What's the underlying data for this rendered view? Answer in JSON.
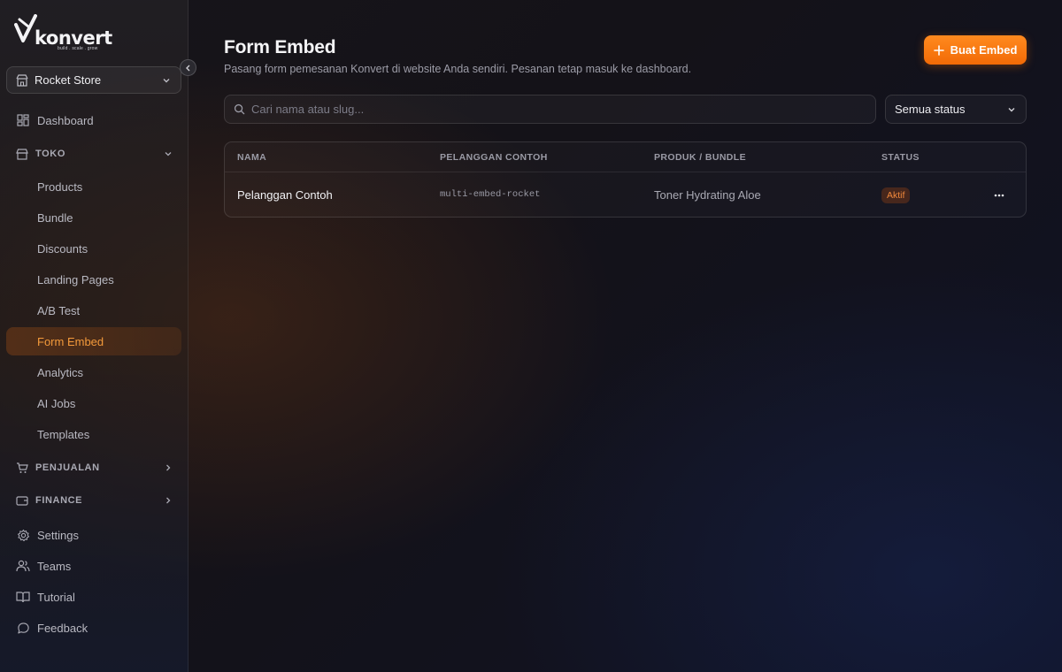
{
  "brand": {
    "name": "konvert",
    "tagline": "build . scale . grow"
  },
  "sidebar": {
    "store": "Rocket Store",
    "items": [
      {
        "label": "Dashboard"
      },
      {
        "label": "TOKO"
      },
      {
        "label": "Products"
      },
      {
        "label": "Bundle"
      },
      {
        "label": "Discounts"
      },
      {
        "label": "Landing Pages"
      },
      {
        "label": "A/B Test"
      },
      {
        "label": "Form Embed"
      },
      {
        "label": "Analytics"
      },
      {
        "label": "AI Jobs"
      },
      {
        "label": "Templates"
      },
      {
        "label": "PENJUALAN"
      },
      {
        "label": "FINANCE"
      },
      {
        "label": "Settings"
      },
      {
        "label": "Teams"
      },
      {
        "label": "Tutorial"
      },
      {
        "label": "Feedback"
      }
    ],
    "active": "Form Embed"
  },
  "page": {
    "title": "Form Embed",
    "subtitle": "Pasang form pemesanan Konvert di website Anda sendiri. Pesanan tetap masuk ke dashboard.",
    "primary_button": "Buat Embed"
  },
  "filters": {
    "search_placeholder": "Cari nama atau slug...",
    "status_selected": "Semua status"
  },
  "table": {
    "columns": [
      "NAMA",
      "PELANGGAN CONTOH",
      "PRODUK / BUNDLE",
      "STATUS"
    ],
    "rows": [
      {
        "name": "Pelanggan Contoh",
        "slug": "multi-embed-rocket",
        "product": "Toner Hydrating Aloe",
        "status": "Aktif"
      }
    ]
  },
  "colors": {
    "accent": "#f26a06",
    "active_text": "#f39a3b",
    "badge_text": "#f0883c"
  }
}
